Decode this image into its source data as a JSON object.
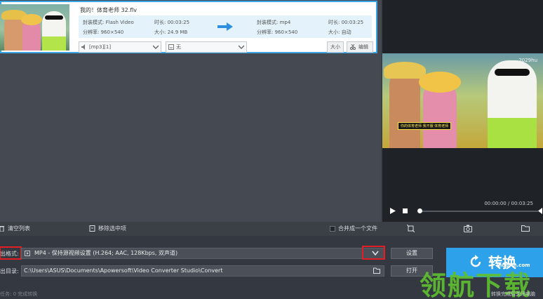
{
  "file_item": {
    "title": "我的！体育老师 32.flv",
    "source": {
      "format_label": "封装模式:",
      "format_value": "Flash Video",
      "resolution_label": "分辨率:",
      "resolution_value": "960×540",
      "duration_label": "时长:",
      "duration_value": "00:03:25",
      "size_label": "大小:",
      "size_value": "24.9 MB"
    },
    "target": {
      "format_label": "封装模式:",
      "format_value": "mp4",
      "resolution_label": "分辨率:",
      "resolution_value": "960×540",
      "duration_label": "时长:",
      "duration_value": "00:03:25",
      "size_label": "大小:",
      "size_value": "自动"
    },
    "audio_track": "[mp3][1]",
    "subtitle": "无",
    "size_button": "大小",
    "edit_button": "编辑"
  },
  "preview": {
    "watermark": "2029hu",
    "caption": "你的体育老师 我不服 体育老师",
    "time_readout": "00:00:00 / 00:03:25",
    "progress": 0.0
  },
  "toolbar": {
    "clear_list": "清空列表",
    "remove_selected": "移除选中项",
    "merge_label": "合并成一个文件"
  },
  "output": {
    "format_label": "出格式:",
    "format_value": "MP4 - 保持源视频设置 (H.264; AAC, 128Kbps, 双声道)",
    "dir_label": "出目录:",
    "dir_value": "C:\\Users\\ASUS\\Documents\\Apowersoft\\Video Converter Studio\\Convert",
    "settings_button": "设置",
    "open_button": "打开",
    "convert_button": "转换",
    "shutdown_text": "转换完成后关闭电脑",
    "status_line": "任务: 0    完成转换"
  },
  "site_watermark": {
    "chars": "领航下载",
    "domain": "lhdown.com"
  },
  "colors": {
    "accent": "#2da2ea",
    "highlight_border": "#e21d24",
    "card_border": "#3aa3e3"
  }
}
